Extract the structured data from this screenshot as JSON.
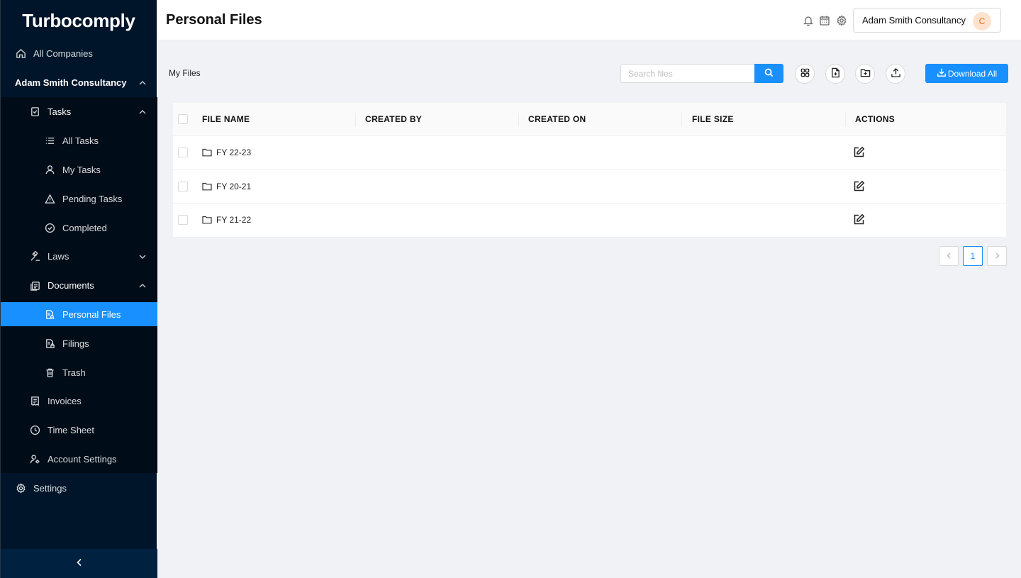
{
  "app": {
    "name": "Turbocomply"
  },
  "sidebar": {
    "items": [
      {
        "label": "All Companies",
        "icon": "home-icon"
      },
      {
        "label": "Adam Smith Consultancy"
      },
      {
        "label": "Tasks",
        "icon": "task-icon"
      },
      {
        "label": "All Tasks",
        "icon": "list-icon"
      },
      {
        "label": "My Tasks",
        "icon": "user-icon"
      },
      {
        "label": "Pending Tasks",
        "icon": "warning-icon"
      },
      {
        "label": "Completed",
        "icon": "check-circle-icon"
      },
      {
        "label": "Laws",
        "icon": "gavel-icon"
      },
      {
        "label": "Documents",
        "icon": "documents-icon"
      },
      {
        "label": "Personal Files",
        "icon": "file-search-icon",
        "active": true
      },
      {
        "label": "Filings",
        "icon": "file-lock-icon"
      },
      {
        "label": "Trash",
        "icon": "trash-icon"
      },
      {
        "label": "Invoices",
        "icon": "invoice-icon"
      },
      {
        "label": "Time Sheet",
        "icon": "clock-icon"
      },
      {
        "label": "Account Settings",
        "icon": "user-gear-icon"
      },
      {
        "label": "Settings",
        "icon": "gear-icon"
      }
    ]
  },
  "header": {
    "title": "Personal Files",
    "company": "Adam Smith Consultancy",
    "avatar_initial": "C"
  },
  "toolbar": {
    "breadcrumb": "My Files",
    "search_placeholder": "Search files",
    "download_label": "Download All"
  },
  "table": {
    "columns": [
      "FILE NAME",
      "CREATED BY",
      "CREATED ON",
      "FILE SIZE",
      "ACTIONS"
    ],
    "rows": [
      {
        "name": "FY 22-23"
      },
      {
        "name": "FY 20-21"
      },
      {
        "name": "FY 21-22"
      }
    ]
  },
  "pagination": {
    "current": "1"
  },
  "colors": {
    "primary": "#1890ff",
    "sidebar_bg": "#001529",
    "submenu_bg": "#000c17"
  }
}
